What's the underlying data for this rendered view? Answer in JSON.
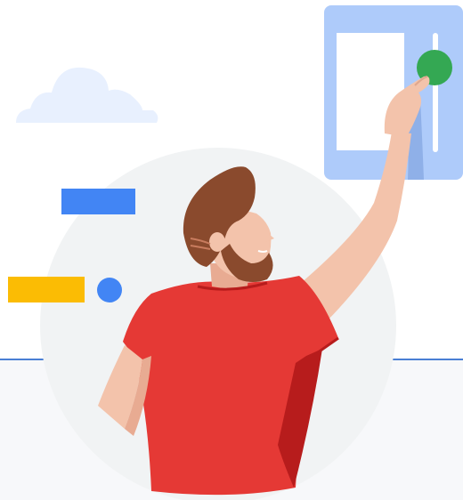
{
  "illustration": {
    "subject": "person-pressing-green-button",
    "icons": [
      "cloud-icon",
      "blue-bar-icon",
      "yellow-bar-icon",
      "blue-dot-icon",
      "control-panel-icon",
      "green-button-icon"
    ]
  },
  "colors": {
    "panel_bg": "#f7f8fa",
    "panel_border": "#4a7fd4",
    "circle": "#f1f3f4",
    "cloud": "#e8f0fe",
    "blue": "#4285f4",
    "yellow": "#fbbc04",
    "green": "#34a853",
    "device": "#aecbfa",
    "shirt": "#e53935",
    "shirt_shadow": "#b71c1c",
    "skin": "#f3c3ab",
    "hair": "#8a4a2d"
  }
}
